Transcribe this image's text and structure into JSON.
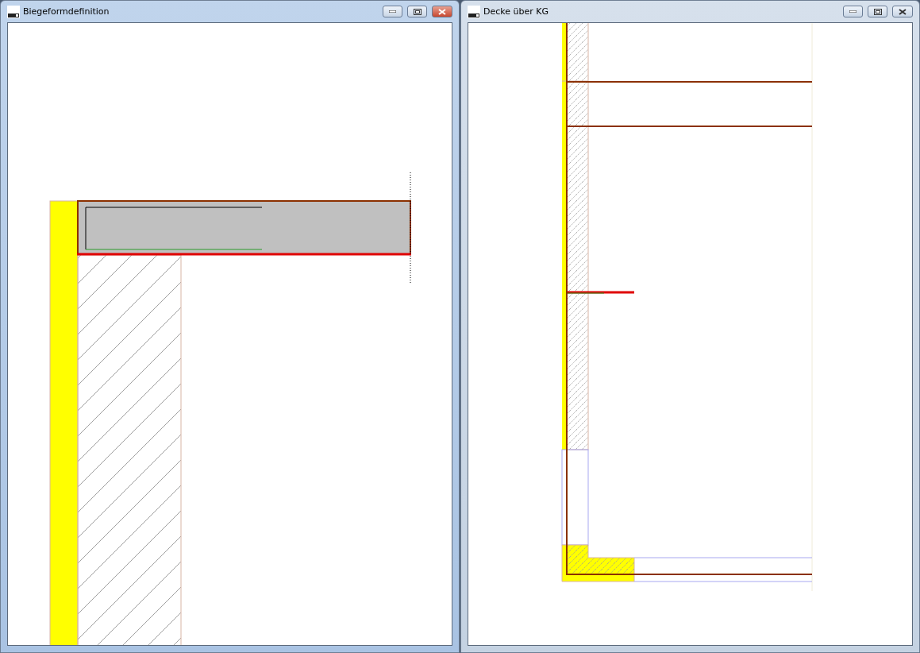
{
  "windows": [
    {
      "title": "Biegeformdefinition",
      "active": true,
      "kind": "section"
    },
    {
      "title": "Decke über KG",
      "active": false,
      "kind": "plan"
    }
  ]
}
